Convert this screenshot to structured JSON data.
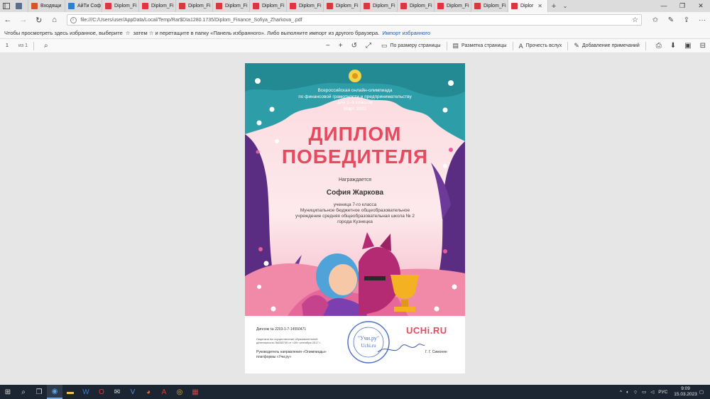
{
  "browser": {
    "tabs": [
      {
        "label": "",
        "icon": "tab-list-icon",
        "color": "#5a6e8c"
      },
      {
        "label": "Входящи",
        "icon": "mail-icon",
        "color": "#d4562a"
      },
      {
        "label": "АйТи Соф",
        "icon": "site-icon",
        "color": "#2f80d1"
      },
      {
        "label": "Diplom_Fi",
        "icon": "pdf-icon",
        "color": "#d9393e"
      },
      {
        "label": "Diplom_Fi",
        "icon": "pdf-icon",
        "color": "#d9393e"
      },
      {
        "label": "Diplom_Fi",
        "icon": "pdf-icon",
        "color": "#d9393e"
      },
      {
        "label": "Diplom_Fi",
        "icon": "pdf-icon",
        "color": "#d9393e"
      },
      {
        "label": "Diplom_Fi",
        "icon": "pdf-icon",
        "color": "#d9393e"
      },
      {
        "label": "Diplom_Fi",
        "icon": "pdf-icon",
        "color": "#d9393e"
      },
      {
        "label": "Diplom_Fi",
        "icon": "pdf-icon",
        "color": "#d9393e"
      },
      {
        "label": "Diplom_Fi",
        "icon": "pdf-icon",
        "color": "#d9393e"
      },
      {
        "label": "Diplom_Fi",
        "icon": "pdf-icon",
        "color": "#d9393e"
      },
      {
        "label": "Diplom_Fi",
        "icon": "pdf-icon",
        "color": "#d9393e"
      },
      {
        "label": "Diplom_Fi",
        "icon": "pdf-icon",
        "color": "#d9393e"
      },
      {
        "label": "Diplor",
        "icon": "pdf-icon",
        "color": "#d9393e",
        "active": true
      }
    ],
    "url": "file:///C:/Users/user/AppData/Local/Temp/Rar$DIa1280.1735/Diplom_Finance_Sofiya_Zharkova_.pdf",
    "favorites_text": "Чтобы просмотреть здесь избранное, выберите",
    "favorites_text2": "затем ☆ и перетащите в папку «Панель избранного». Либо выполните импорт из другого браузера.",
    "favorites_link": "Импорт избранного"
  },
  "pdf_toolbar": {
    "page": "1",
    "page_of": "из 1",
    "fit_label": "По размеру страницы",
    "layout_label": "Разметка страницы",
    "read_label": "Прочесть вслух",
    "notes_label": "Добавление примечаний"
  },
  "diploma": {
    "header_line1": "Всероссийская онлайн-олимпиада",
    "header_line2": "по финансовой грамотности и предпринимательству",
    "header_line3": "для 1–9 классов",
    "header_line4": "Март 2022",
    "title1": "ДИПЛОМ",
    "title2": "ПОБЕДИТЕЛЯ",
    "awarded": "Награждается",
    "name": "София Жаркова",
    "detail1": "ученица 7-го класса",
    "detail2": "Муниципальное бюджетное общеобразовательное",
    "detail3": "учреждение средняя общеобразовательная школа № 2",
    "detail4": "города Кузнецка",
    "diploma_no": "Диплом № 2203-1-7-14550471",
    "license1": "Лицензия на осуществление образовательной",
    "license2": "деятельности №038749 от «20» сентября 2017 г.",
    "signer1": "Руководитель направления «Олимпиады»",
    "signer2": "платформы «Учи.ру»",
    "signer_name": "Г. Г. Симонян",
    "brand": "UCHi.RU",
    "stamp_text1": "\"Учи.ру\"",
    "stamp_text2": "Uchi.ru",
    "colors": {
      "title": "#e8495f",
      "teal": "#2d9ea8",
      "purple": "#5a2d82",
      "brand": "#e8495f"
    }
  },
  "taskbar": {
    "lang": "РУС",
    "time": "9:09",
    "date": "15.03.2023"
  }
}
